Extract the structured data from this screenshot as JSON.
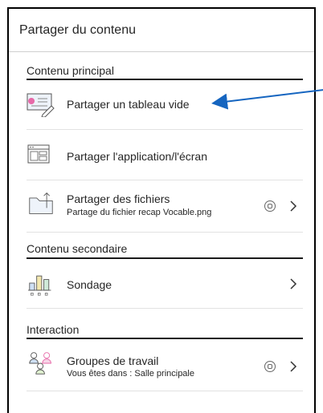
{
  "panel": {
    "title": "Partager du contenu"
  },
  "sections": {
    "primary": {
      "header": "Contenu principal",
      "items": [
        {
          "label": "Partager un tableau vide",
          "icon": "whiteboard-icon"
        },
        {
          "label": "Partager l'application/l'écran",
          "icon": "screen-share-icon"
        },
        {
          "label": "Partager des fichiers",
          "sub": "Partage du fichier recap Vocable.png",
          "icon": "folder-upload-icon"
        }
      ]
    },
    "secondary": {
      "header": "Contenu secondaire",
      "items": [
        {
          "label": "Sondage",
          "icon": "poll-chart-icon"
        }
      ]
    },
    "interaction": {
      "header": "Interaction",
      "items": [
        {
          "label": "Groupes de travail",
          "sub": "Vous êtes dans : Salle principale",
          "icon": "groups-icon"
        }
      ]
    }
  },
  "colors": {
    "annotation_arrow": "#1565c0",
    "text": "#262626",
    "rule": "#1a1a1a"
  }
}
